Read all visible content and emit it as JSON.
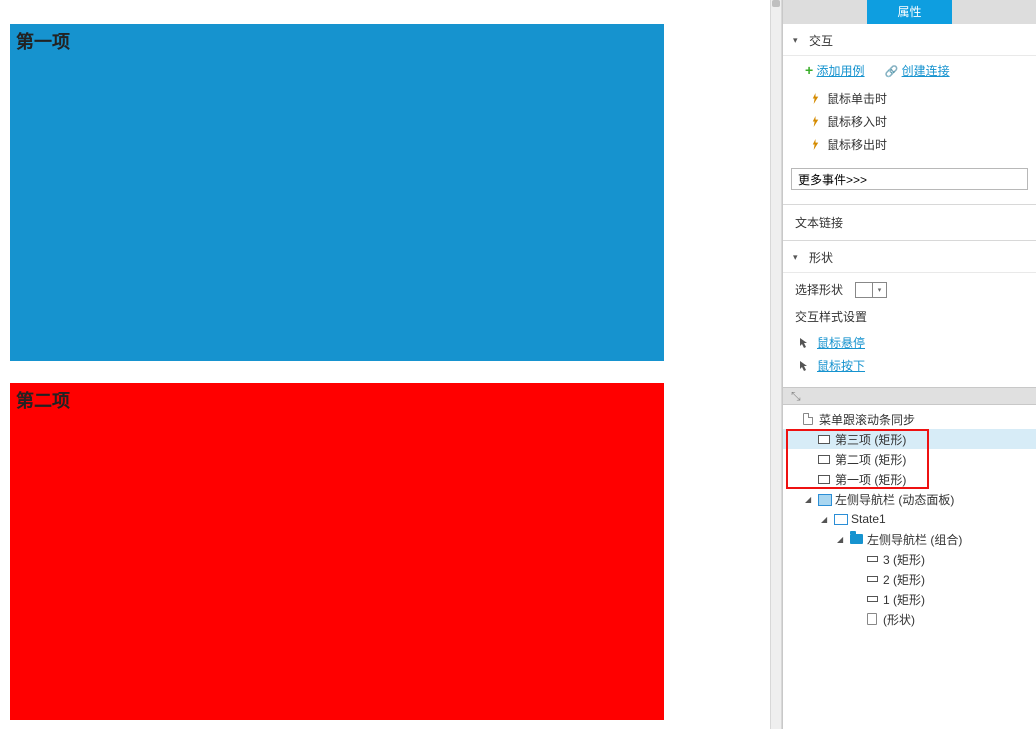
{
  "canvas": {
    "block1": "第一项",
    "block2": "第二项"
  },
  "panel": {
    "tab_active": "属性",
    "sections": {
      "interaction": "交互",
      "shape": "形状"
    },
    "add_case": "添加用例",
    "create_link": "创建连接",
    "events": {
      "click": "鼠标单击时",
      "mousein": "鼠标移入时",
      "mouseout": "鼠标移出时"
    },
    "more_events": "更多事件>>>",
    "text_link": "文本链接",
    "select_shape": "选择形状",
    "istyle_title": "交互样式设置",
    "istyle_hover": "鼠标悬停",
    "istyle_down": "鼠标按下"
  },
  "outline": {
    "root": "菜单跟滚动条同步",
    "item3": "第三项 (矩形)",
    "item2": "第二项 (矩形)",
    "item1": "第一项 (矩形)",
    "nav_panel": "左侧导航栏 (动态面板)",
    "state1": "State1",
    "nav_group": "左侧导航栏 (组合)",
    "r3": "3 (矩形)",
    "r2": "2 (矩形)",
    "r1": "1 (矩形)",
    "shape": "(形状)"
  }
}
